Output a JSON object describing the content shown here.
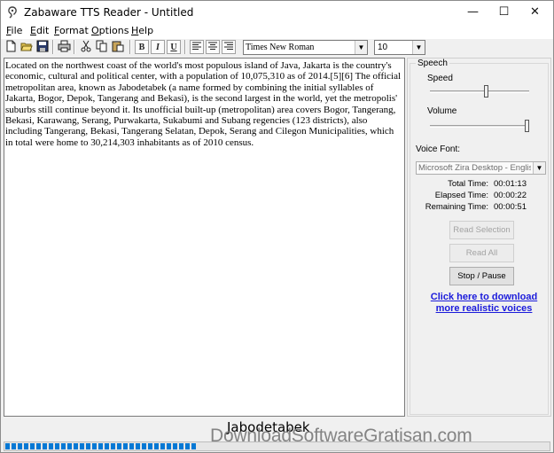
{
  "window": {
    "title": "Zabaware TTS Reader - Untitled",
    "icon": "ear-icon",
    "controls": {
      "minimize": "—",
      "maximize": "☐",
      "close": "✕"
    }
  },
  "menu": {
    "items": [
      {
        "name": "file",
        "accel": "F",
        "rest": "ile"
      },
      {
        "name": "edit",
        "accel": "E",
        "rest": "dit"
      },
      {
        "name": "format",
        "accel": "F",
        "rest": "ormat"
      },
      {
        "name": "options",
        "accel": "O",
        "rest": "ptions"
      },
      {
        "name": "help",
        "accel": "H",
        "rest": "elp"
      }
    ]
  },
  "toolbar": {
    "new_icon": "new-document-icon",
    "open_icon": "open-folder-icon",
    "save_icon": "save-disk-icon",
    "print_icon": "printer-icon",
    "cut_icon": "scissors-icon",
    "copy_icon": "copy-icon",
    "paste_icon": "paste-icon",
    "bold_label": "B",
    "italic_label": "I",
    "underline_label": "U",
    "font_name": "Times New Roman",
    "font_size": "10"
  },
  "editor": {
    "text": "Located on the northwest coast of the world's most populous island of Java, Jakarta is the country's economic, cultural and political center, with a population of 10,075,310 as of 2014.[5][6] The official metropolitan area, known as Jabodetabek (a name formed by combining the initial syllables of Jakarta, Bogor, Depok, Tangerang and Bekasi), is the second largest in the world, yet the metropolis' suburbs still continue beyond it. Its unofficial built-up (metropolitan) area covers Bogor, Tangerang, Bekasi, Karawang, Serang, Purwakarta, Sukabumi and Subang regencies (123 districts), also including Tangerang, Bekasi, Tangerang Selatan, Depok, Serang and Cilegon Municipalities, which in total were home to 30,214,303 inhabitants as of 2010 census."
  },
  "panel": {
    "group_label": "Speech",
    "speed_label": "Speed",
    "speed_level": 0.57,
    "volume_label": "Volume",
    "volume_level": 1.0,
    "voice_font_label": "Voice Font:",
    "voice_font_value": "Microsoft Zira Desktop - English (U",
    "total_time_label": "Total Time:",
    "total_time_value": "00:01:13",
    "elapsed_time_label": "Elapsed Time:",
    "elapsed_time_value": "00:00:22",
    "remaining_time_label": "Remaining Time:",
    "remaining_time_value": "00:00:51",
    "read_selection_label": "Read Selection",
    "read_all_label": "Read All",
    "stop_pause_label": "Stop / Pause",
    "download_link_line1": "Click here to download",
    "download_link_line2": "more realistic voices"
  },
  "status": {
    "current_word": "Jabodetabek",
    "progress_fraction": 0.36,
    "progress_color": "#0678d4"
  },
  "watermark": "DownloadSoftwareGratisan.com"
}
